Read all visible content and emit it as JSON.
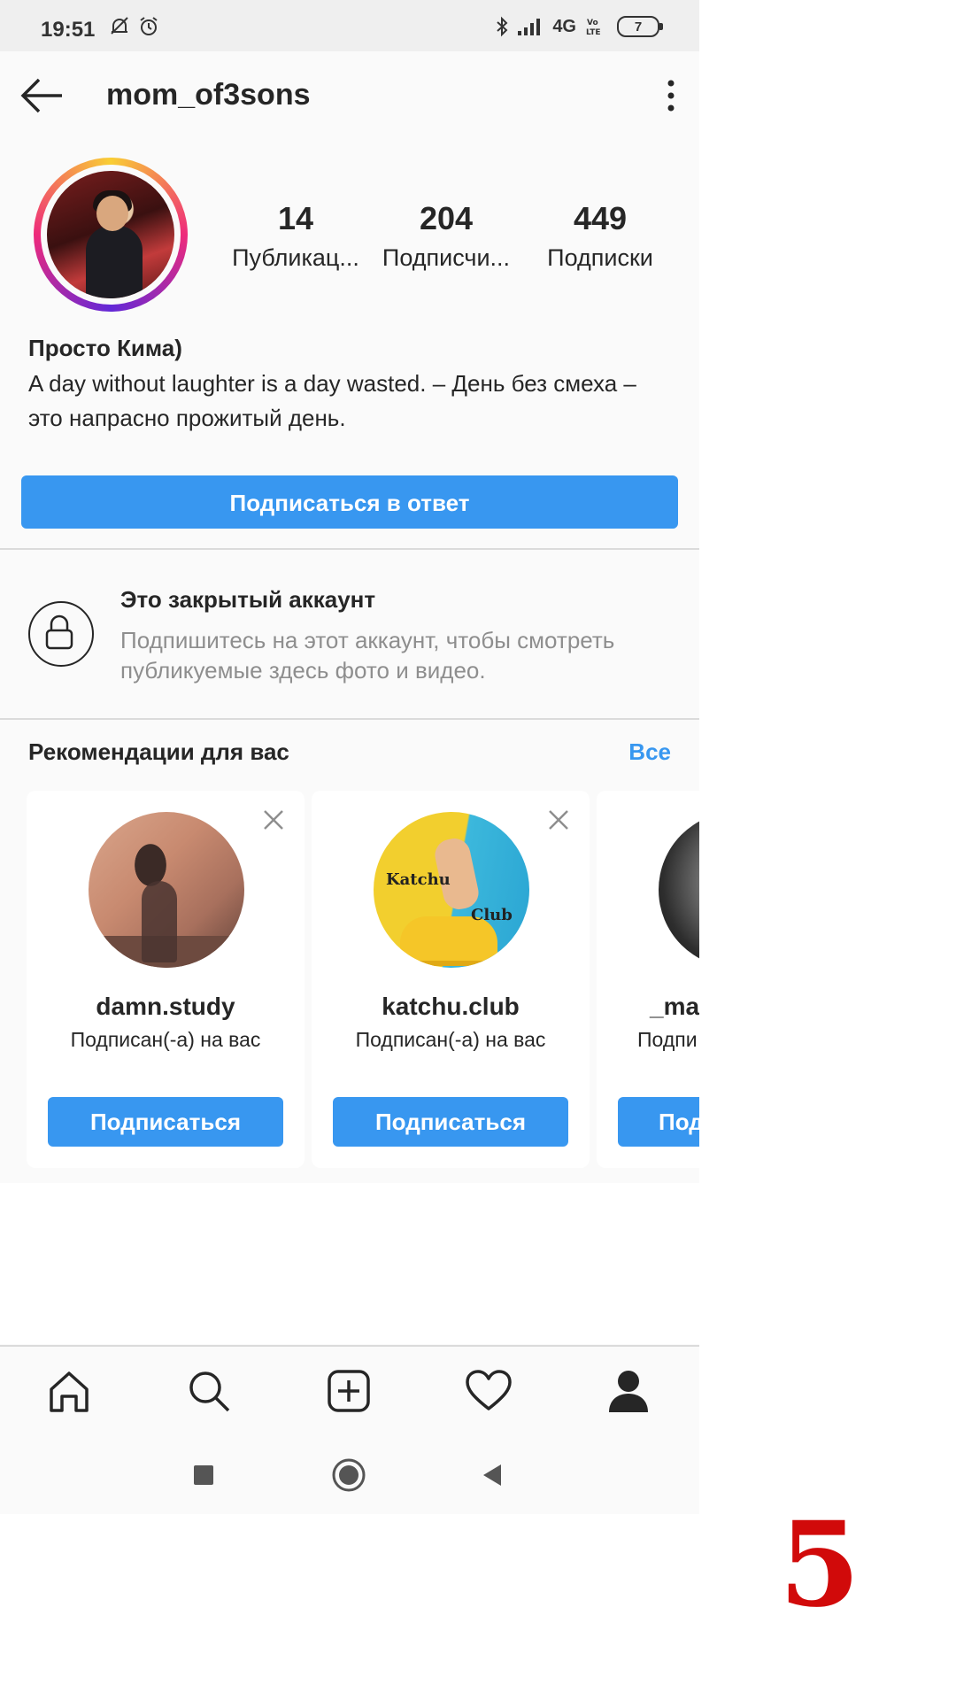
{
  "status_bar": {
    "time": "19:51",
    "network": "4G",
    "battery": "7",
    "icons": [
      "mute-icon",
      "alarm-icon",
      "bluetooth-icon",
      "signal-icon",
      "volte-icon"
    ]
  },
  "header": {
    "username": "mom_of3sons"
  },
  "profile": {
    "stats": [
      {
        "value": "14",
        "label": "Публикац..."
      },
      {
        "value": "204",
        "label": "Подписчи..."
      },
      {
        "value": "449",
        "label": "Подписки"
      }
    ],
    "bio_name": "Просто Кима)",
    "bio_text": "A day without laughter is a day wasted. – День без смеха – это напрасно прожитый день.",
    "follow_back_label": "Подписаться в ответ"
  },
  "private_account": {
    "title": "Это закрытый аккаунт",
    "description": "Подпишитесь на этот аккаунт, чтобы смотреть публикуемые здесь фото и видео."
  },
  "suggestions": {
    "title": "Рекомендации для вас",
    "see_all": "Все",
    "cards": [
      {
        "name": "damn.study",
        "subtitle": "Подписан(-а) на вас",
        "button": "Подписаться"
      },
      {
        "name": "katchu.club",
        "subtitle": "Подписан(-а) на вас",
        "button": "Подписаться",
        "avatar_text_1": "Katchu",
        "avatar_text_2": "Club"
      },
      {
        "name": "_mar",
        "subtitle": "Подпи",
        "button": "Под"
      }
    ]
  },
  "bottom_nav": [
    "home-icon",
    "search-icon",
    "add-post-icon",
    "activity-heart-icon",
    "profile-icon"
  ],
  "overlay_number": "5",
  "colors": {
    "accent": "#3897f0",
    "overlay_number": "#d10a0a"
  }
}
